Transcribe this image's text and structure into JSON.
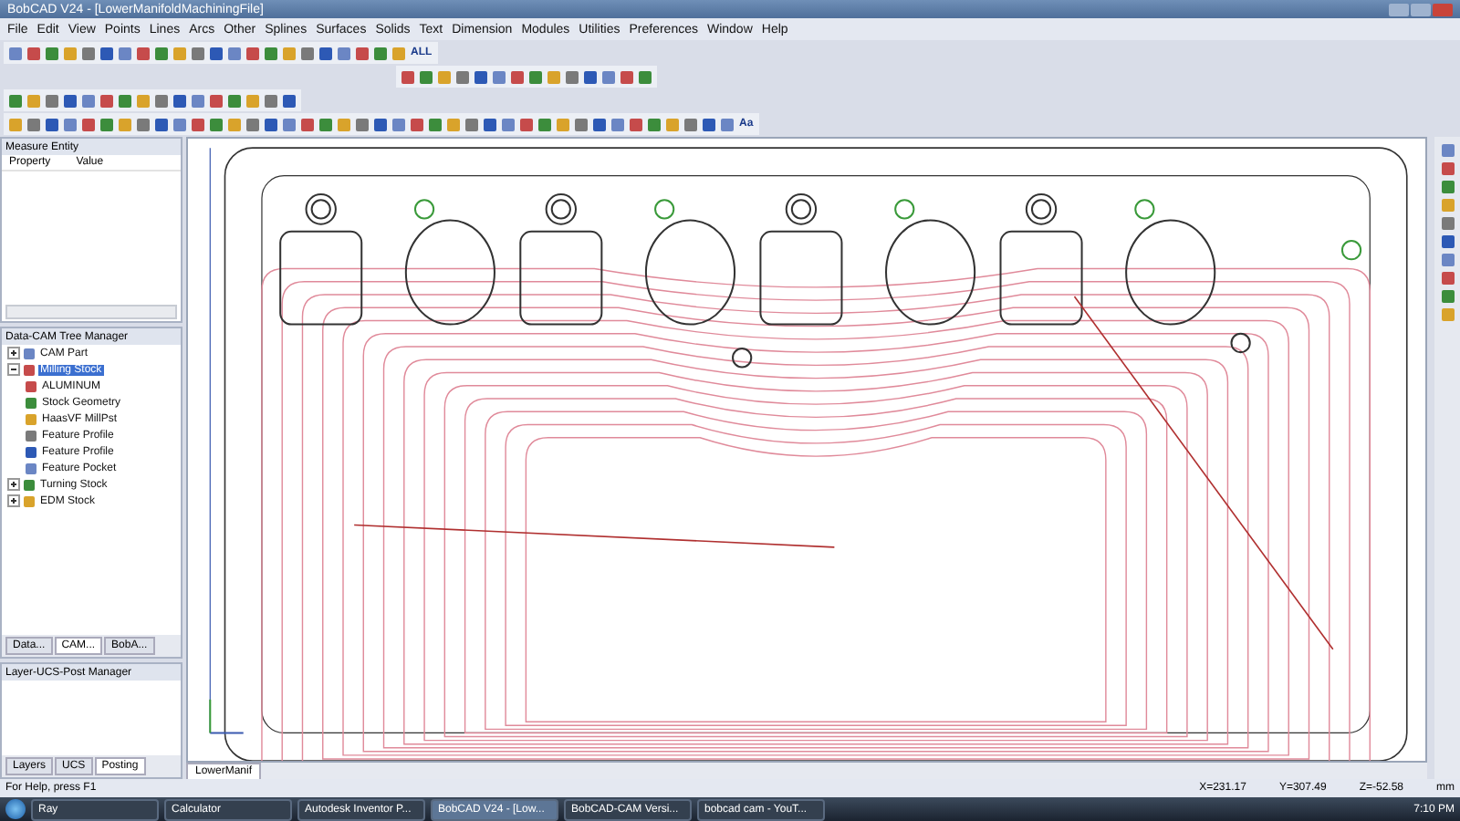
{
  "window": {
    "title": "BobCAD V24 - [LowerManifoldMachiningFile]"
  },
  "menu": [
    "File",
    "Edit",
    "View",
    "Points",
    "Lines",
    "Arcs",
    "Other",
    "Splines",
    "Surfaces",
    "Solids",
    "Text",
    "Dimension",
    "Modules",
    "Utilities",
    "Preferences",
    "Window",
    "Help"
  ],
  "toolbar_texts": [
    "ALL",
    "Aa"
  ],
  "measure_panel": {
    "title": "Measure Entity",
    "columns": [
      "Property",
      "Value"
    ]
  },
  "tree_panel": {
    "title": "Data-CAM Tree Manager",
    "items": [
      {
        "label": "CAM Part",
        "selected": false,
        "expanded": false
      },
      {
        "label": "Milling Stock",
        "selected": true,
        "expanded": true,
        "children": [
          {
            "label": "ALUMINUM",
            "selected": false
          },
          {
            "label": "Stock Geometry",
            "selected": false
          },
          {
            "label": "HaasVF MillPst",
            "selected": false
          },
          {
            "label": "Feature Profile",
            "selected": false
          },
          {
            "label": "Feature Profile",
            "selected": false
          },
          {
            "label": "Feature Pocket",
            "selected": false
          }
        ]
      },
      {
        "label": "Turning Stock",
        "selected": false,
        "expanded": false
      },
      {
        "label": "EDM Stock",
        "selected": false,
        "expanded": false
      }
    ],
    "tabs": [
      {
        "label": "Data...",
        "selected": false
      },
      {
        "label": "CAM...",
        "selected": true
      },
      {
        "label": "BobA...",
        "selected": false
      }
    ]
  },
  "layer_panel": {
    "title": "Layer-UCS-Post Manager",
    "tabs": [
      {
        "label": "Layers",
        "selected": false
      },
      {
        "label": "UCS",
        "selected": false
      },
      {
        "label": "Posting",
        "selected": true
      }
    ]
  },
  "document_tab": "LowerManif",
  "status_bar": {
    "help": "For Help, press F1",
    "x": "X=231.17",
    "y": "Y=307.49",
    "z": "Z=-52.58",
    "units": "mm"
  },
  "taskbar": {
    "items": [
      {
        "label": "Ray",
        "selected": false
      },
      {
        "label": "Calculator",
        "selected": false
      },
      {
        "label": "Autodesk Inventor P...",
        "selected": false
      },
      {
        "label": "BobCAD V24 - [Low...",
        "selected": true
      },
      {
        "label": "BobCAD-CAM Versi...",
        "selected": false
      },
      {
        "label": "bobcad cam - YouT...",
        "selected": false
      }
    ],
    "clock": "7:10 PM"
  }
}
